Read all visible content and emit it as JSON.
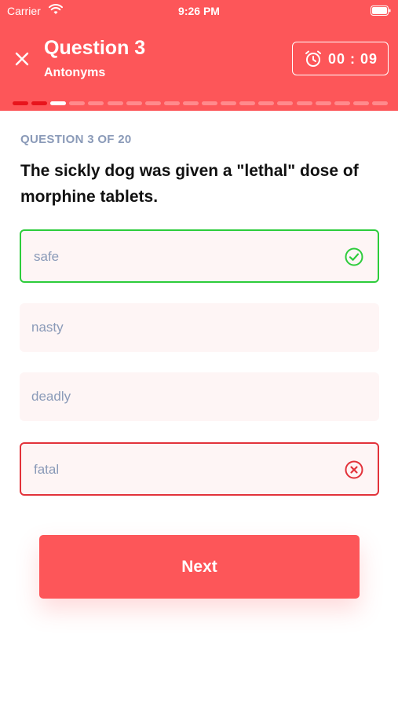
{
  "status_bar": {
    "carrier": "Carrier",
    "time": "9:26 PM"
  },
  "header": {
    "title": "Question 3",
    "subtitle": "Antonyms",
    "timer": "00 : 09",
    "close_icon": "close-icon",
    "timer_icon": "alarm-clock-icon"
  },
  "progress": {
    "total": 20,
    "answered": 2,
    "current": 3
  },
  "question": {
    "counter": "QUESTION 3 OF 20",
    "text": "The sickly dog was given a \"lethal\" dose of morphine tablets."
  },
  "options": [
    {
      "label": "safe",
      "state": "correct",
      "icon": "check-circle-icon"
    },
    {
      "label": "nasty",
      "state": "neutral"
    },
    {
      "label": "deadly",
      "state": "neutral"
    },
    {
      "label": "fatal",
      "state": "wrong",
      "icon": "x-circle-icon"
    }
  ],
  "next_label": "Next",
  "colors": {
    "primary": "#fd5659",
    "correct": "#2dcc3b",
    "wrong": "#e2323a",
    "option_bg": "#fef5f5",
    "muted_text": "#8a9ab8",
    "progress_done": "#e8141c",
    "progress_current": "#ffffff",
    "progress_pending": "#ff8a8c"
  }
}
